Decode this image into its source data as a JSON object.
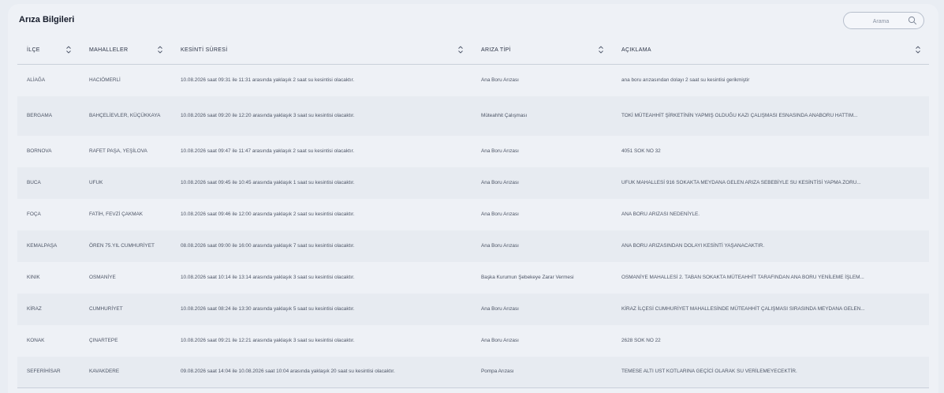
{
  "panel": {
    "title": "Arıza Bilgileri",
    "search": {
      "placeholder": "Arama"
    }
  },
  "table": {
    "headers": [
      "İLÇE",
      "MAHALLELER",
      "KESİNTİ SÜRESİ",
      "ARIZA TİPİ",
      "AÇIKLAMA"
    ],
    "rows": [
      {
        "ilce": "ALİAĞA",
        "mahalleler": "HACIÖMERLİ",
        "sure": "10.08.2026 saat 09:31 ile 11:31 arasında yaklaşık 2 saat su kesintisi olacaktır.",
        "tip": "Ana Boru Arızası",
        "aciklama": "ana boru arızasından dolayı 2 saat su kesintisi gerikmiştir"
      },
      {
        "ilce": "BERGAMA",
        "mahalleler": "BAHÇELİEVLER, KÜÇÜKKAYA",
        "sure": "10.08.2026 saat 09:20 ile 12:20 arasında yaklaşık 3 saat su kesintisi olacaktır.",
        "tip": "Müteahhit Çalışması",
        "aciklama": "TOKİ MÜTEAHHİT ŞİRKETİNİN YAPMIŞ OLDUĞU KAZI ÇALIŞMASI ESNASINDA ANABORU HATTIM..."
      },
      {
        "ilce": "BORNOVA",
        "mahalleler": "RAFET PAŞA, YEŞİLOVA",
        "sure": "10.08.2026 saat 09:47 ile 11:47 arasında yaklaşık 2 saat su kesintisi olacaktır.",
        "tip": "Ana Boru Arızası",
        "aciklama": "4051 SOK NO 32"
      },
      {
        "ilce": "BUCA",
        "mahalleler": "UFUK",
        "sure": "10.08.2026 saat 09:45 ile 10:45 arasında yaklaşık 1 saat su kesintisi olacaktır.",
        "tip": "Ana Boru Arızası",
        "aciklama": "UFUK MAHALLESİ 916 SOKAKTA MEYDANA GELEN ARIZA SEBEBİYLE SU KESİNTİSİ YAPMA ZORU..."
      },
      {
        "ilce": "FOÇA",
        "mahalleler": "FATİH, FEVZİ ÇAKMAK",
        "sure": "10.08.2026 saat 09:46 ile 12:00 arasında yaklaşık 2 saat su kesintisi olacaktır.",
        "tip": "Ana Boru Arızası",
        "aciklama": "ANA BORU ARIZASI NEDENİYLE."
      },
      {
        "ilce": "KEMALPAŞA",
        "mahalleler": "ÖREN 75.YIL CUMHURİYET",
        "sure": "08.08.2026 saat 09:00 ile 16:00 arasında yaklaşık 7 saat su kesintisi olacaktır.",
        "tip": "Ana Boru Arızası",
        "aciklama": "ANA BORU ARIZASINDAN DOLAYI KESİNTİ YAŞANACAKTIR."
      },
      {
        "ilce": "KINIK",
        "mahalleler": "OSMANİYE",
        "sure": "10.08.2026 saat 10:14 ile 13:14 arasında yaklaşık 3 saat su kesintisi olacaktır.",
        "tip": "Başka Kurumun Şebekeye Zarar Vermesi",
        "aciklama": "OSMANİYE MAHALLESİ 2. TABAN SOKAKTA MÜTEAHHİT TARAFINDAN ANA BORU YENİLEME İŞLEM..."
      },
      {
        "ilce": "KİRAZ",
        "mahalleler": "CUMHURİYET",
        "sure": "10.08.2026 saat 08:24 ile 13:30 arasında yaklaşık 5 saat su kesintisi olacaktır.",
        "tip": "Ana Boru Arızası",
        "aciklama": "KİRAZ İLÇESİ CUMHURİYET MAHALLESİNDE MÜTEAHHİT ÇALIŞMASI SIRASINDA MEYDANA GELEN..."
      },
      {
        "ilce": "KONAK",
        "mahalleler": "ÇINARTEPE",
        "sure": "10.08.2026 saat 09:21 ile 12:21 arasında yaklaşık 3 saat su kesintisi olacaktır.",
        "tip": "Ana Boru Arızası",
        "aciklama": "2628 SOK NO 22"
      },
      {
        "ilce": "SEFERİHİSAR",
        "mahalleler": "KAVAKDERE",
        "sure": "09.08.2026 saat 14:04 ile 10.08.2026 saat 10:04 arasında yaklaşık 20 saat su kesintisi olacaktır.",
        "tip": "Pompa Arızası",
        "aciklama": "TEMESE ALTI UST KOTLARINA GEÇİCİ OLARAK SU VERİLEMEYECEKTİR."
      }
    ]
  }
}
